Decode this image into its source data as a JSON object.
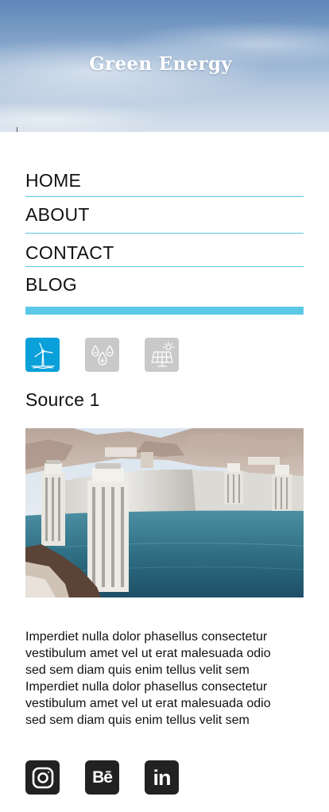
{
  "header": {
    "title": "Green Energy"
  },
  "nav": {
    "items": [
      {
        "label": "HOME"
      },
      {
        "label": "ABOUT"
      },
      {
        "label": "CONTACT"
      },
      {
        "label": "BLOG"
      }
    ],
    "accent_color": "#5bc9e6"
  },
  "sources": {
    "tabs": [
      {
        "icon": "wind-turbine-icon",
        "active": true
      },
      {
        "icon": "water-drops-icon",
        "active": false
      },
      {
        "icon": "solar-panel-icon",
        "active": false
      }
    ],
    "active_color": "#0aa0da",
    "inactive_color": "#c9c9c9",
    "heading": "Source 1",
    "image": "hydroelectric-dam-photo",
    "description_lines": [
      "Imperdiet nulla dolor phasellus consectetur",
      "vestibulum amet vel ut erat malesuada odio",
      "sed sem diam quis enim tellus velit sem",
      "Imperdiet nulla dolor phasellus consectetur",
      "vestibulum amet vel ut erat malesuada odio",
      "sed sem diam quis enim tellus velit sem"
    ]
  },
  "social": {
    "links": [
      {
        "icon": "instagram-icon"
      },
      {
        "icon": "behance-icon",
        "label": "Bē"
      },
      {
        "icon": "linkedin-icon",
        "label": "in"
      }
    ]
  }
}
